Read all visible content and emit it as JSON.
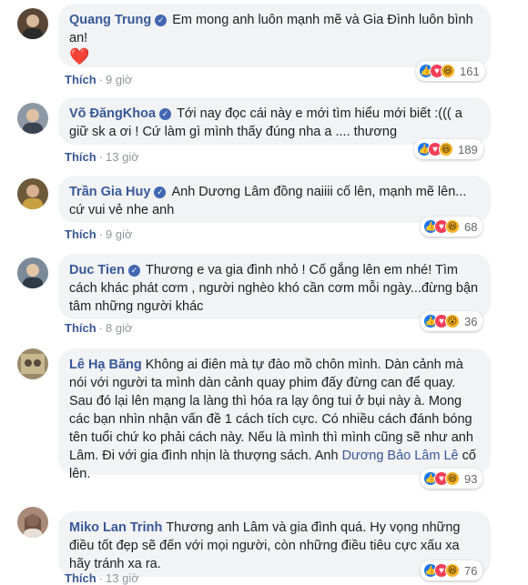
{
  "comments": [
    {
      "name": "Quang Trung",
      "verified": true,
      "text": "Em mong anh luôn mạnh mẽ và Gia Đình luôn bình an!",
      "emoji": "❤️",
      "like_label": "Thích",
      "time": "9 giờ",
      "reaction_count": "161",
      "reaction_icons": [
        "like-icon",
        "love-icon",
        "haha-icon"
      ],
      "avatar_color": "#5a4636"
    },
    {
      "name": "Võ ĐăngKhoa",
      "verified": true,
      "text": "Tới nay đọc cái này e mới tìm hiểu mới biết :((( a giữ sk a ơi ! Cứ làm gì mình thấy đúng nha a .... thương",
      "like_label": "Thích",
      "time": "13 giờ",
      "reaction_count": "189",
      "reaction_icons": [
        "like-icon",
        "love-icon",
        "haha-icon"
      ],
      "avatar_color": "#8d99a6"
    },
    {
      "name": "Trần Gia Huy",
      "verified": true,
      "text": "Anh Dương Lâm đồng naiiii cố lên, mạnh mẽ lên... cứ vui vẻ nhe anh",
      "like_label": "Thích",
      "time": "9 giờ",
      "reaction_count": "68",
      "reaction_icons": [
        "like-icon",
        "love-icon",
        "haha-icon"
      ],
      "avatar_color": "#6d5a3a"
    },
    {
      "name": "Duc Tien",
      "verified": true,
      "text": "Thương e va gia đình nhỏ ! Cố gắng lên em nhé! Tìm cách khác phát cơm , người nghèo khó cần cơm mỗi ngày...đừng bận tâm những người khác",
      "like_label": "Thích",
      "time": "8 giờ",
      "reaction_count": "36",
      "reaction_icons": [
        "like-icon",
        "love-icon",
        "wow-icon"
      ],
      "avatar_color": "#7a8a98"
    },
    {
      "name": "Lê Hạ Băng",
      "verified": false,
      "text_before": "Không ai điên mà tự đào mồ chôn mình. Dàn cảnh mà nói với người ta mình dàn cảnh quay phim đấy đừng can để quay. Sau đó lại lên mạng la làng thì hóa ra lạy ông tui ở bụi này à. Mong các bạn nhìn nhận vấn đề 1 cách tích cực. Có nhiều cách đánh bóng tên tuổi chứ ko phải cách này. Nếu là mình thì mình cũng sẽ như anh Lâm. Đi với gia đình nhịn là thượng sách. Anh",
      "mention": "Dương Bảo Lâm Lê",
      "text_after": "cố lên.",
      "like_label": "Thích",
      "time": "",
      "reaction_count": "93",
      "reaction_icons": [
        "like-icon",
        "love-icon",
        "haha-icon"
      ],
      "avatar_color": "#9a8a6a"
    },
    {
      "name": "Miko Lan Trinh",
      "verified": false,
      "text": "Thương anh Lâm và gia đình quá. Hy vọng những điều tốt đẹp sẽ đến với mọi người, còn những điều tiêu cực xấu xa hãy tránh xa ra.",
      "like_label": "Thích",
      "time": "13 giờ",
      "reaction_count": "76",
      "reaction_icons": [
        "like-icon",
        "love-icon",
        "haha-icon"
      ],
      "avatar_color": "#a88a78"
    }
  ]
}
